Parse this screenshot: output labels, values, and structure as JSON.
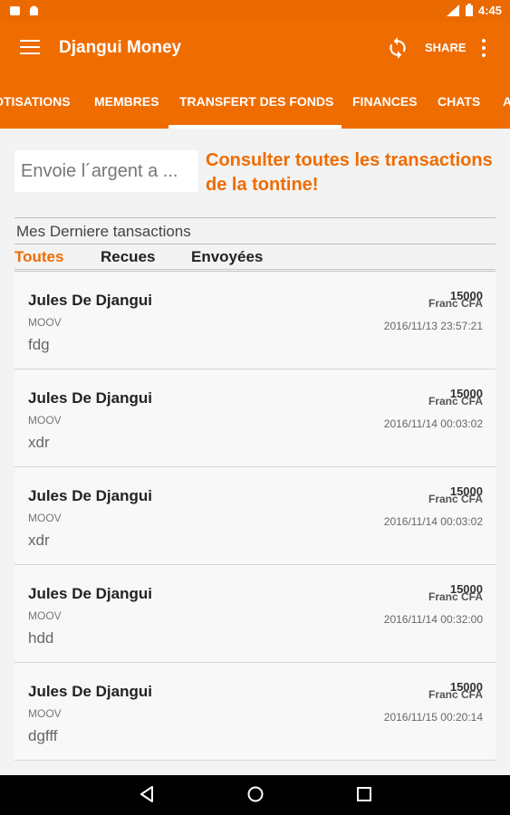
{
  "status_bar": {
    "time": "4:45",
    "network_badge": "LTE"
  },
  "app_bar": {
    "title": "Djangui Money",
    "share_label": "SHARE"
  },
  "tabs": [
    {
      "label": "COTISATIONS"
    },
    {
      "label": "MEMBRES"
    },
    {
      "label": "TRANSFERT DES FONDS",
      "active": true
    },
    {
      "label": "FINANCES"
    },
    {
      "label": "CHATS"
    },
    {
      "label": "A"
    }
  ],
  "send": {
    "placeholder": "Envoie l´argent a ..."
  },
  "consult_link": "Consulter toutes les transactions de la tontine!",
  "recent_title": "Mes Derniere tansactions",
  "filters": [
    {
      "label": "Toutes",
      "active": true
    },
    {
      "label": "Recues"
    },
    {
      "label": "Envoyées"
    }
  ],
  "transactions": [
    {
      "name": "Jules De Djangui",
      "operator": "MOOV",
      "note": "fdg",
      "amount": "15000",
      "currency": "Franc CFA",
      "date": "2016/11/13 23:57:21"
    },
    {
      "name": "Jules De Djangui",
      "operator": "MOOV",
      "note": "xdr",
      "amount": "15000",
      "currency": "Franc CFA",
      "date": "2016/11/14 00:03:02"
    },
    {
      "name": "Jules De Djangui",
      "operator": "MOOV",
      "note": "xdr",
      "amount": "15000",
      "currency": "Franc CFA",
      "date": "2016/11/14 00:03:02"
    },
    {
      "name": "Jules De Djangui",
      "operator": "MOOV",
      "note": "hdd",
      "amount": "15000",
      "currency": "Franc CFA",
      "date": "2016/11/14 00:32:00"
    },
    {
      "name": "Jules De Djangui",
      "operator": "MOOV",
      "note": "dgfff",
      "amount": "15000",
      "currency": "Franc CFA",
      "date": "2016/11/15 00:20:14"
    }
  ],
  "colors": {
    "accent": "#ef6c00",
    "status_bar": "#ea6a00",
    "nav_bar": "#000000"
  }
}
